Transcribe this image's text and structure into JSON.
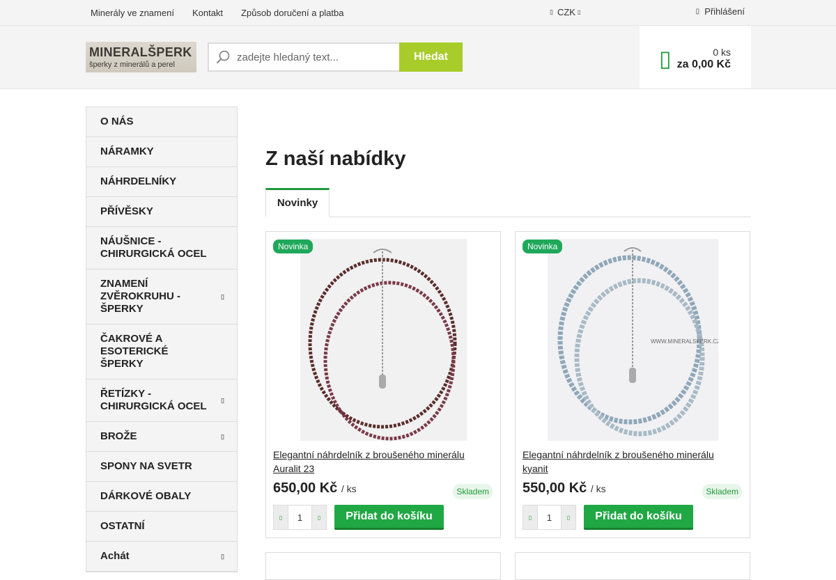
{
  "topbar": {
    "links": [
      "Minerály ve znamení",
      "Kontakt",
      "Způsob doručení a platba"
    ],
    "currency": "CZK",
    "login": "Přihlášení"
  },
  "header": {
    "logo_title": "MINERALŠPERK",
    "logo_tagline": "šperky z minerálů a perel",
    "search_placeholder": "zadejte hledaný text...",
    "search_button": "Hledat",
    "cart_count": "0 ks",
    "cart_total": "za 0,00 Kč"
  },
  "sidebar": {
    "items": [
      {
        "label": "O NÁS",
        "has_sub": false
      },
      {
        "label": "NÁRAMKY",
        "has_sub": false
      },
      {
        "label": "NÁHRDELNÍKY",
        "has_sub": false
      },
      {
        "label": "PŘÍVĚSKY",
        "has_sub": false
      },
      {
        "label": "NÁUŠNICE - CHIRURGICKÁ OCEL",
        "has_sub": false
      },
      {
        "label": "ZNAMENÍ ZVĚROKRUHU - ŠPERKY",
        "has_sub": true
      },
      {
        "label": "ČAKROVÉ A ESOTERICKÉ ŠPERKY",
        "has_sub": false
      },
      {
        "label": "ŘETÍZKY - CHIRURGICKÁ OCEL",
        "has_sub": true
      },
      {
        "label": "BROŽE",
        "has_sub": true
      },
      {
        "label": "SPONY NA SVETR",
        "has_sub": false
      },
      {
        "label": "DÁRKOVÉ OBALY",
        "has_sub": false
      },
      {
        "label": "OSTATNÍ",
        "has_sub": false
      },
      {
        "label": "Achát",
        "has_sub": true
      }
    ]
  },
  "main": {
    "title": "Z naší nabídky",
    "tab": "Novinky",
    "products": [
      {
        "badge": "Novinka",
        "name": "Elegantní náhrdelník z broušeného minerálu Auralit 23",
        "price": "650,00 Kč",
        "unit": "/ ks",
        "stock": "Skladem",
        "qty": "1",
        "add_label": "Přidat do košíku"
      },
      {
        "badge": "Novinka",
        "name": "Elegantní náhrdelník z broušeného minerálu kyanit",
        "price": "550,00 Kč",
        "unit": "/ ks",
        "stock": "Skladem",
        "qty": "1",
        "add_label": "Přidat do košíku",
        "watermark": "WWW.MINERALSPERK.CZ"
      }
    ]
  },
  "colors": {
    "accent_green": "#1fa843",
    "search_button": "#a8cc2a",
    "badge": "#1fa85a"
  }
}
